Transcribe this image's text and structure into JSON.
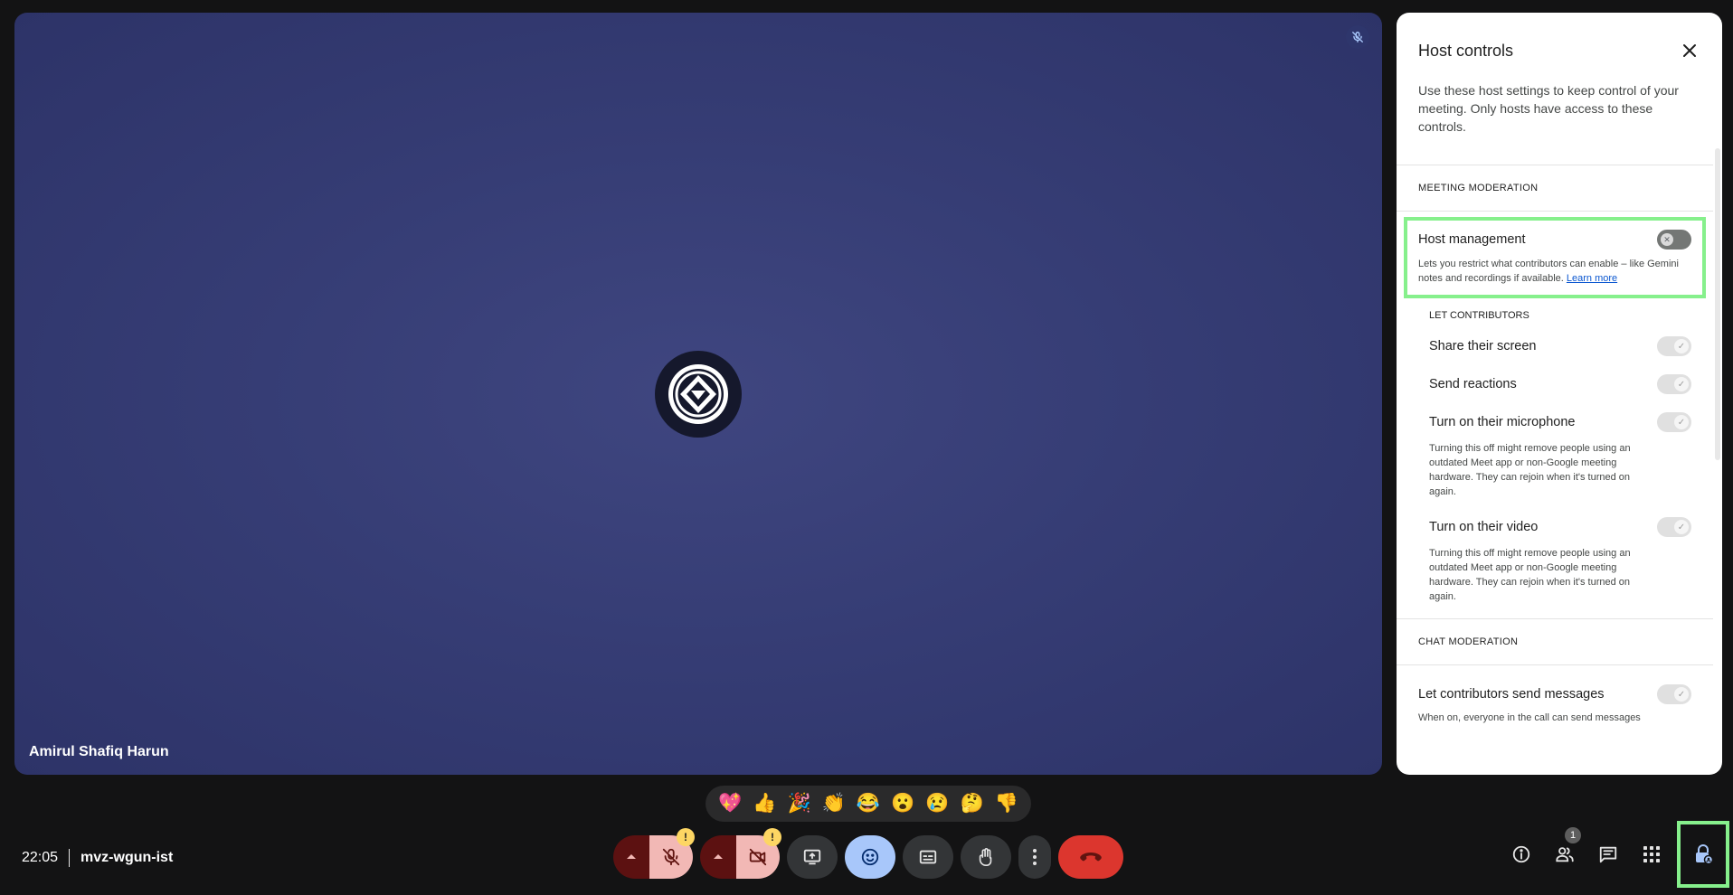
{
  "tile": {
    "participant_name": "Amirul Shafiq Harun"
  },
  "panel": {
    "title": "Host controls",
    "description": "Use these host settings to keep control of your meeting. Only hosts have access to these controls.",
    "meeting_moderation_label": "MEETING MODERATION",
    "host_management": {
      "title": "Host management",
      "description": "Lets you restrict what contributors can enable – like Gemini notes and recordings if available.",
      "link": "Learn more",
      "state": "off"
    },
    "let_contributors_label": "LET CONTRIBUTORS",
    "options": [
      {
        "title": "Share their screen",
        "description": "",
        "state": "on"
      },
      {
        "title": "Send reactions",
        "description": "",
        "state": "on"
      },
      {
        "title": "Turn on their microphone",
        "description": "Turning this off might remove people using an outdated Meet app or non-Google meeting hardware. They can rejoin when it's turned on again.",
        "state": "on"
      },
      {
        "title": "Turn on their video",
        "description": "Turning this off might remove people using an outdated Meet app or non-Google meeting hardware. They can rejoin when it's turned on again.",
        "state": "on"
      }
    ],
    "chat_moderation_label": "CHAT MODERATION",
    "chat": {
      "title": "Let contributors send messages",
      "description": "When on, everyone in the call can send messages",
      "state": "on"
    }
  },
  "reactions": [
    "💖",
    "👍",
    "🎉",
    "👏",
    "😂",
    "😮",
    "😢",
    "🤔",
    "👎"
  ],
  "meeting": {
    "time": "22:05",
    "code": "mvz-wgun-ist"
  },
  "bottom": {
    "warn_badge": "!",
    "people_count": "1"
  },
  "colors": {
    "accent_highlight": "#86f08c",
    "end_call": "#dc362e",
    "muted_bg": "#f2b8b5",
    "active_reaction_btn": "#a8c7fa"
  }
}
